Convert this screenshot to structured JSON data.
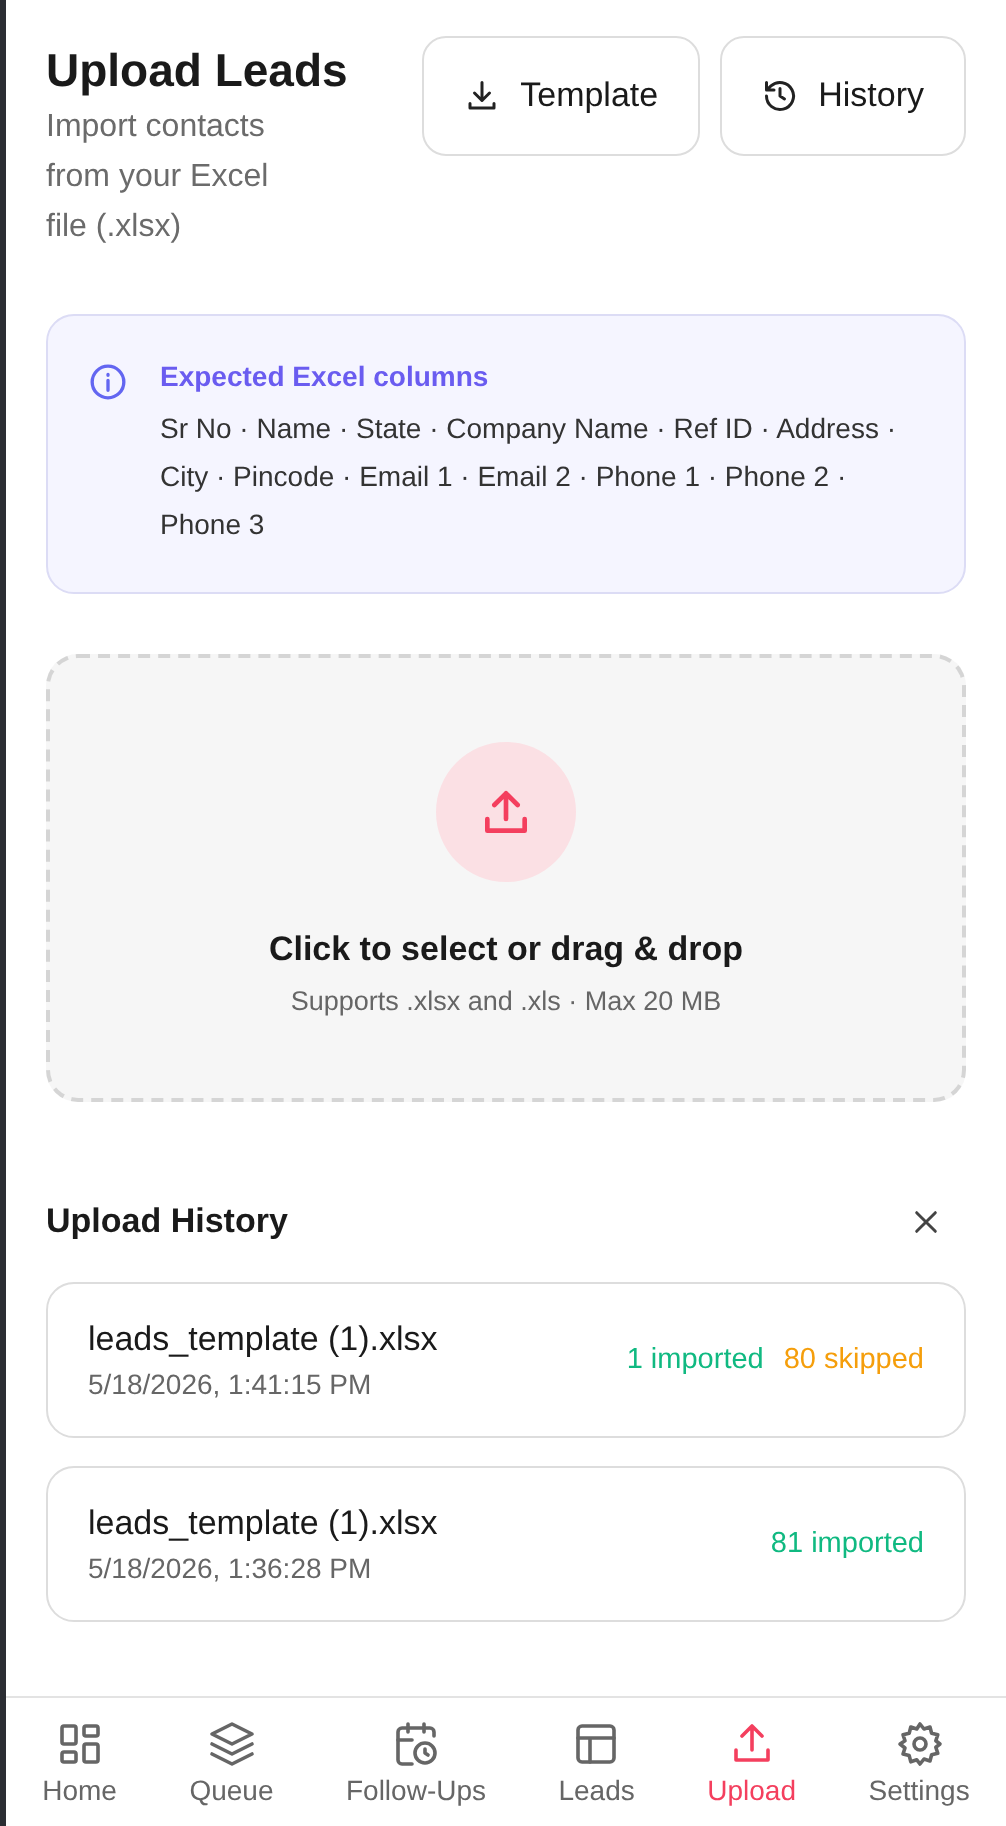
{
  "header": {
    "title": "Upload Leads",
    "subtitle": "Import contacts from your Excel file (.xlsx)",
    "buttons": [
      {
        "label": "Template",
        "kind": "download"
      },
      {
        "label": "History",
        "kind": "history"
      }
    ]
  },
  "info": {
    "title": "Expected Excel columns",
    "text": "Sr No · Name · State · Company Name · Ref ID · Address · City · Pincode · Email 1 · Email 2 · Phone 1 · Phone 2 · Phone 3"
  },
  "dropzone": {
    "title": "Click to select or drag & drop",
    "hint": "Supports .xlsx and .xls · Max 20 MB"
  },
  "history": {
    "title": "Upload History",
    "items": [
      {
        "file": "leads_template (1).xlsx",
        "time": "5/18/2026, 1:41:15 PM",
        "stats": [
          {
            "kind": "imported",
            "text": "1 imported"
          },
          {
            "kind": "skipped",
            "text": "80 skipped"
          }
        ]
      },
      {
        "file": "leads_template (1).xlsx",
        "time": "5/18/2026, 1:36:28 PM",
        "stats": [
          {
            "kind": "imported",
            "text": "81 imported"
          }
        ]
      }
    ]
  },
  "nav": [
    {
      "label": "Home",
      "kind": "home",
      "selected": false
    },
    {
      "label": "Queue",
      "kind": "queue",
      "selected": false
    },
    {
      "label": "Follow-Ups",
      "kind": "followups",
      "selected": false
    },
    {
      "label": "Leads",
      "kind": "leads",
      "selected": false
    },
    {
      "label": "Upload",
      "kind": "upload",
      "selected": true
    },
    {
      "label": "Settings",
      "kind": "settings",
      "selected": false
    }
  ]
}
